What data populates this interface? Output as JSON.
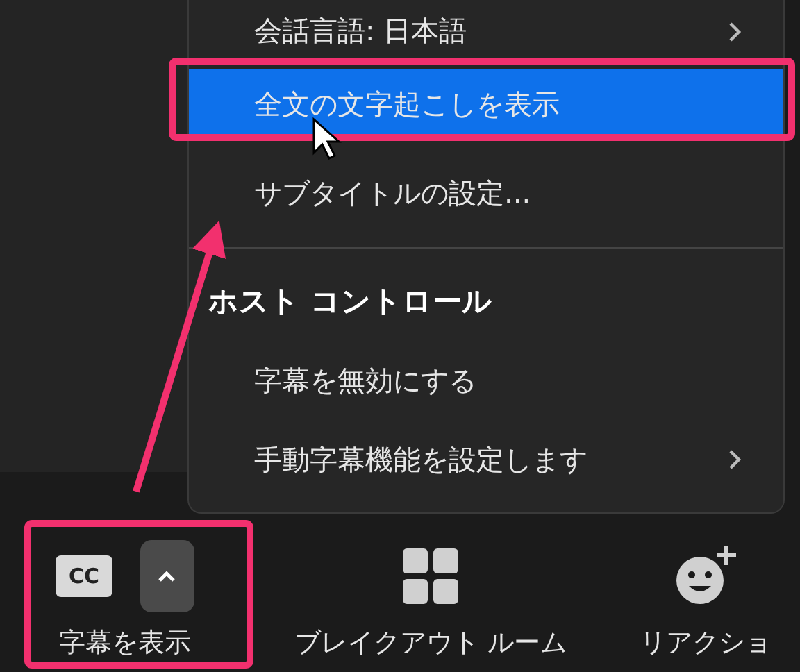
{
  "menu": {
    "items": [
      {
        "kind": "item",
        "label": "会話言語: 日本語",
        "submenu": true,
        "selected": false
      },
      {
        "kind": "item",
        "label": "全文の文字起こしを表示",
        "submenu": false,
        "selected": true
      },
      {
        "kind": "item",
        "label": "サブタイトルの設定...",
        "submenu": false,
        "selected": false
      },
      {
        "kind": "divider"
      },
      {
        "kind": "header",
        "label": "ホスト コントロール"
      },
      {
        "kind": "item",
        "label": "字幕を無効にする",
        "submenu": false,
        "selected": false
      },
      {
        "kind": "item",
        "label": "手動字幕機能を設定します",
        "submenu": true,
        "selected": false
      }
    ]
  },
  "toolbar": {
    "buttons": [
      {
        "kind": "cc",
        "badge": "CC",
        "label": "字幕を表示",
        "caret": true
      },
      {
        "kind": "grid",
        "label": "ブレイクアウト ルーム"
      },
      {
        "kind": "emoji",
        "label": "リアクショ"
      }
    ]
  }
}
